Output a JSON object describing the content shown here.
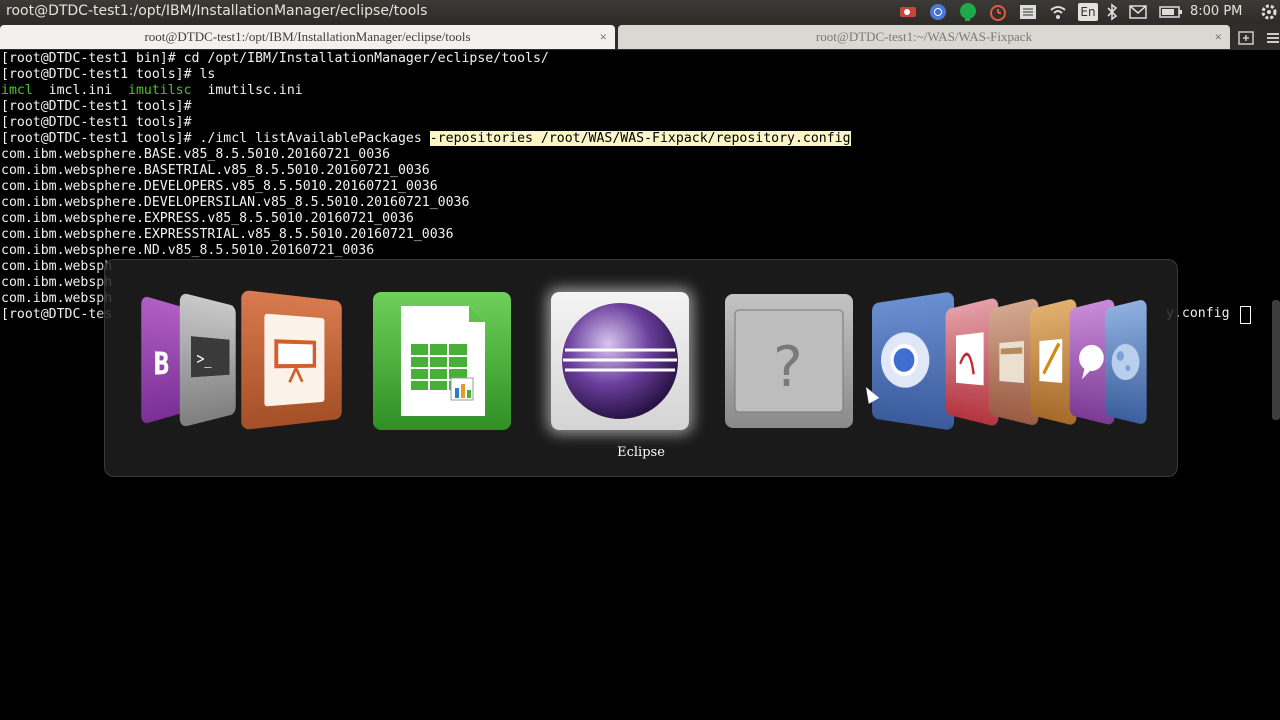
{
  "top_panel": {
    "window_title": "root@DTDC-test1:/opt/IBM/InstallationManager/eclipse/tools",
    "clock": "8:00 PM",
    "keyboard": "En",
    "tray_icons": [
      "record-icon",
      "chrome-icon",
      "hangouts-icon",
      "alarm-icon",
      "list-icon",
      "wifi-icon",
      "keyboard-layout-icon",
      "bluetooth-icon",
      "mail-icon",
      "battery-icon",
      "settings-icon"
    ]
  },
  "tabs": [
    {
      "title": "root@DTDC-test1:/opt/IBM/InstallationManager/eclipse/tools",
      "close": "×"
    },
    {
      "title": "root@DTDC-test1:~/WAS/WAS-Fixpack",
      "close": "×"
    }
  ],
  "terminal": {
    "lines": [
      "[root@DTDC-test1 bin]# cd /opt/IBM/InstallationManager/eclipse/tools/",
      "[root@DTDC-test1 tools]# ls",
      "",
      "[root@DTDC-test1 tools]#",
      "[root@DTDC-test1 tools]#",
      "[root@DTDC-test1 tools]# ./imcl listAvailablePackages ",
      "com.ibm.websphere.BASE.v85_8.5.5010.20160721_0036",
      "com.ibm.websphere.BASETRIAL.v85_8.5.5010.20160721_0036",
      "com.ibm.websphere.DEVELOPERS.v85_8.5.5010.20160721_0036",
      "com.ibm.websphere.DEVELOPERSILAN.v85_8.5.5010.20160721_0036",
      "com.ibm.websphere.EXPRESS.v85_8.5.5010.20160721_0036",
      "com.ibm.websphere.EXPRESSTRIAL.v85_8.5.5010.20160721_0036",
      "com.ibm.websphere.ND.v85_8.5.5010.20160721_0036",
      "com.ibm.websph",
      "com.ibm.websph",
      "com.ibm.websph",
      "[root@DTDC-tes"
    ],
    "ls_output": {
      "imcl": "imcl",
      "imcl_ini": "  imcl.ini  ",
      "imutilsc": "imutilsc",
      "imutilsc_ini": "  imutilsc.ini"
    },
    "highlighted": "-repositories /root/WAS/WAS-Fixpack/repository.config",
    "trailing_text": "y.config"
  },
  "switcher": {
    "label": "Eclipse",
    "apps": [
      "onenote-icon",
      "terminal-icon",
      "impress-icon",
      "calc-icon",
      "eclipse-icon",
      "unknown-app-icon",
      "chromium-icon",
      "acrobat-icon",
      "files-icon",
      "text-editor-icon",
      "pidgin-icon",
      "firefox-icon"
    ]
  }
}
